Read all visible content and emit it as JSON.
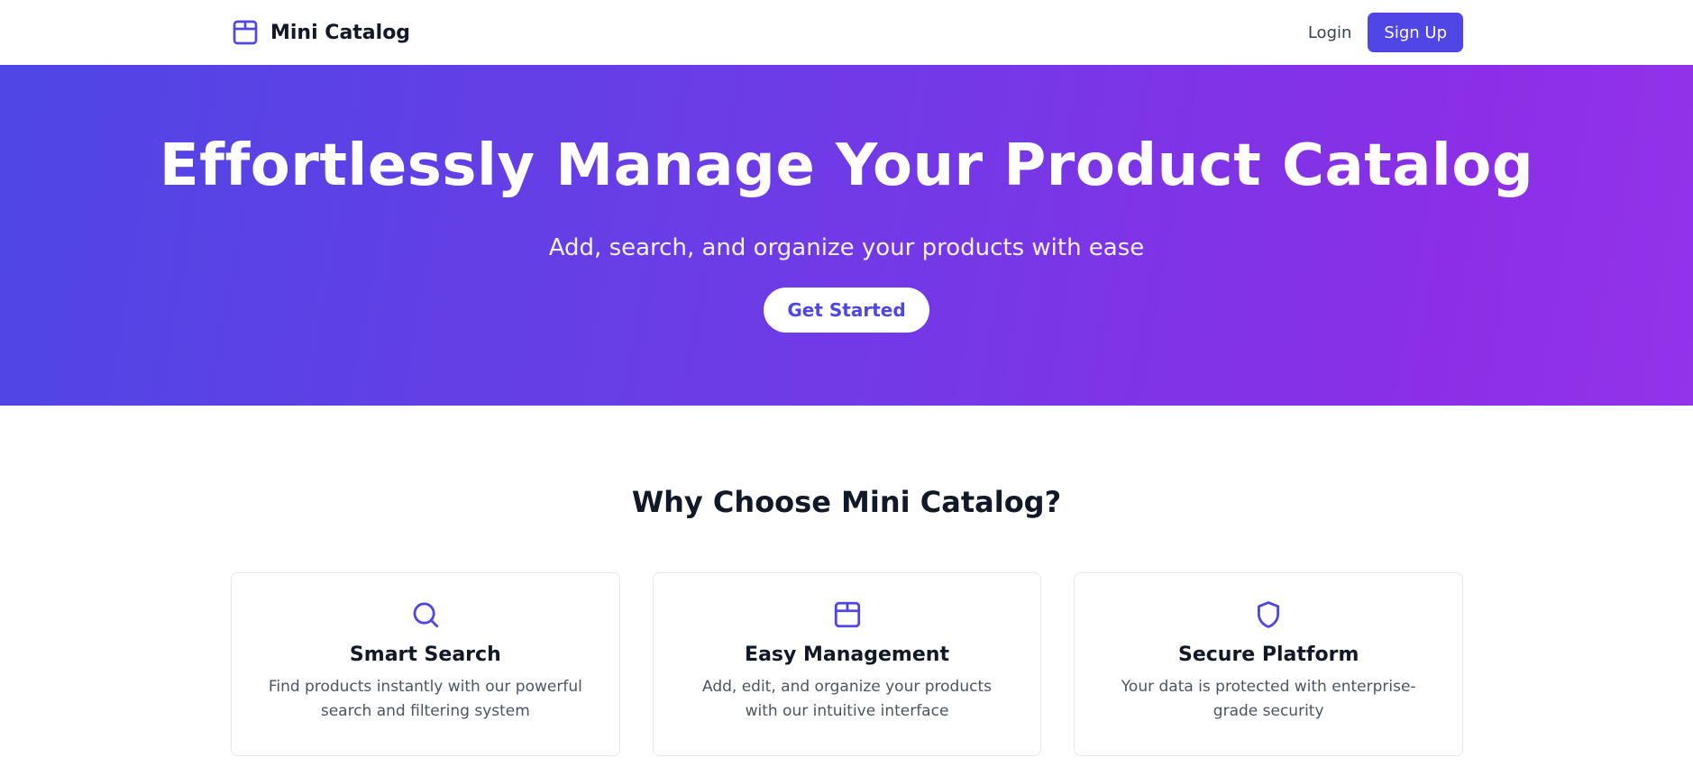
{
  "header": {
    "brand_icon": "package-icon",
    "brand_name": "Mini Catalog",
    "login_label": "Login",
    "signup_label": "Sign Up"
  },
  "hero": {
    "title": "Effortlessly Manage Your Product Catalog",
    "subtitle": "Add, search, and organize your products with ease",
    "cta_label": "Get Started"
  },
  "features": {
    "title": "Why Choose Mini Catalog?",
    "items": [
      {
        "icon": "search-icon",
        "title": "Smart Search",
        "description": "Find products instantly with our powerful search and filtering system"
      },
      {
        "icon": "package-icon",
        "title": "Easy Management",
        "description": "Add, edit, and organize your products with our intuitive interface"
      },
      {
        "icon": "shield-icon",
        "title": "Secure Platform",
        "description": "Your data is protected with enterprise-grade security"
      }
    ]
  },
  "colors": {
    "accent": "#4f46e5",
    "gradient_start": "#4f46e5",
    "gradient_end": "#9333ea"
  }
}
